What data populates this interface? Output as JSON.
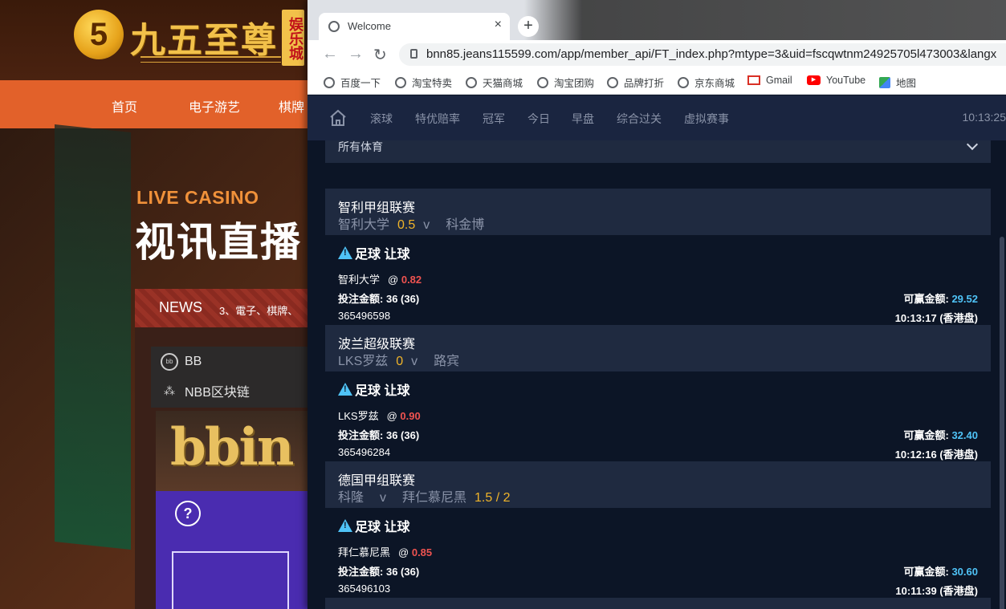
{
  "background_site": {
    "logo_text": "九五至尊",
    "logo_badge": "娱乐城",
    "nav": [
      "首页",
      "电子游艺",
      "棋牌"
    ],
    "live_casino": "LIVE CASINO",
    "live_title": "视讯直播",
    "news_label": "NEWS",
    "news_text": "3、電子、棋牌、",
    "games": [
      "BB",
      "NBB区块链"
    ],
    "bbin_logo": "bbin",
    "help": "?"
  },
  "browser": {
    "tab_title": "Welcome",
    "tab_close": "×",
    "new_tab": "+",
    "url": "bnn85.jeans115599.com/app/member_api/FT_index.php?mtype=3&uid=fscqwtnm24925705l473003&langx",
    "bookmarks": [
      "百度一下",
      "淘宝特卖",
      "天猫商城",
      "淘宝团购",
      "品牌打折",
      "京东商城",
      "Gmail",
      "YouTube",
      "地图"
    ]
  },
  "app": {
    "nav": [
      "滚球",
      "特优赔率",
      "冠军",
      "今日",
      "早盘",
      "综合过关",
      "虚拟赛事"
    ],
    "clock": "10:13:25",
    "sport_filter": "所有体育",
    "bets": [
      {
        "league": "智利甲组联赛",
        "home": "智利大学",
        "handicap": "0.5",
        "vs": "v",
        "away": "科金博",
        "bet_type": "足球 让球",
        "pick": "智利大学",
        "at": "@",
        "odds": "0.82",
        "stake_label": "投注金额:",
        "stake": "36 (36)",
        "win_label": "可赢金额:",
        "win": "29.52",
        "ticket": "365496598",
        "time": "10:13:17 (香港盘)"
      },
      {
        "league": "波兰超级联赛",
        "home": "LKS罗兹",
        "handicap": "0",
        "vs": "v",
        "away": "路宾",
        "bet_type": "足球 让球",
        "pick": "LKS罗兹",
        "at": "@",
        "odds": "0.90",
        "stake_label": "投注金额:",
        "stake": "36 (36)",
        "win_label": "可赢金额:",
        "win": "32.40",
        "ticket": "365496284",
        "time": "10:12:16 (香港盘)"
      },
      {
        "league": "德国甲组联赛",
        "home": "科隆",
        "vs": "v",
        "away": "拜仁慕尼黑",
        "handicap": "1.5 / 2",
        "bet_type": "足球 让球",
        "pick": "拜仁慕尼黑",
        "at": "@",
        "odds": "0.85",
        "stake_label": "投注金额:",
        "stake": "36 (36)",
        "win_label": "可赢金额:",
        "win": "30.60",
        "ticket": "365496103",
        "time": "10:11:39 (香港盘)"
      }
    ]
  },
  "colors": {
    "app_bg": "#0c1526",
    "card_head": "#1f2a40",
    "odds": "#ef5350",
    "win": "#4fc3f7",
    "handicap": "#f0b429",
    "site_orange": "#e2612a"
  }
}
